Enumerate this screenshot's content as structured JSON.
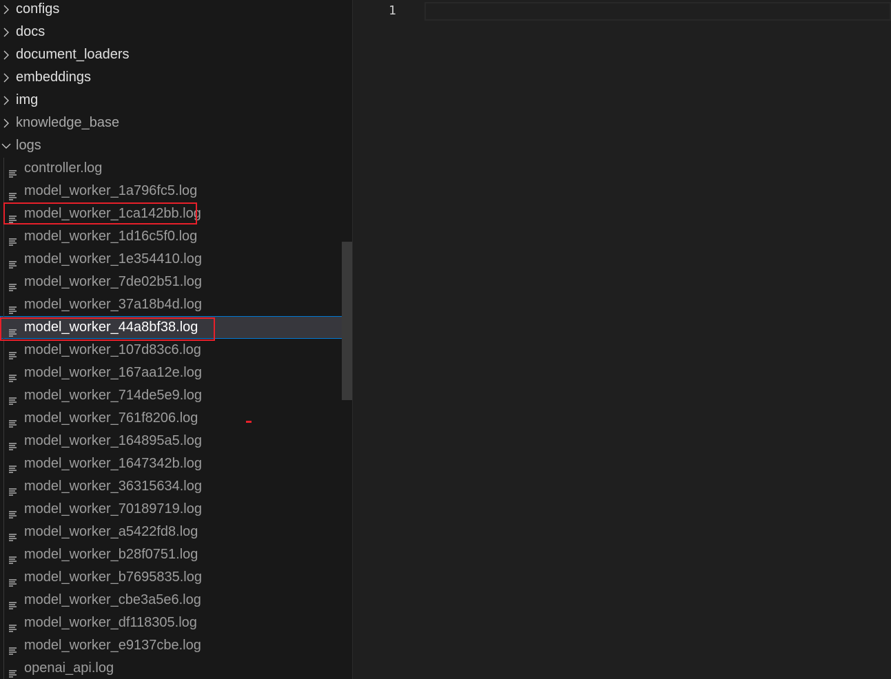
{
  "explorer": {
    "folders_top": [
      {
        "label": "configs",
        "expanded": false,
        "dim": false
      },
      {
        "label": "docs",
        "expanded": false,
        "dim": false
      },
      {
        "label": "document_loaders",
        "expanded": false,
        "dim": false
      },
      {
        "label": "embeddings",
        "expanded": false,
        "dim": false
      },
      {
        "label": "img",
        "expanded": false,
        "dim": false
      },
      {
        "label": "knowledge_base",
        "expanded": false,
        "dim": true
      },
      {
        "label": "logs",
        "expanded": true,
        "dim": true
      }
    ],
    "log_files": [
      "controller.log",
      "model_worker_1a796fc5.log",
      "model_worker_1ca142bb.log",
      "model_worker_1d16c5f0.log",
      "model_worker_1e354410.log",
      "model_worker_7de02b51.log",
      "model_worker_37a18b4d.log",
      "model_worker_44a8bf38.log",
      "model_worker_107d83c6.log",
      "model_worker_167aa12e.log",
      "model_worker_714de5e9.log",
      "model_worker_761f8206.log",
      "model_worker_164895a5.log",
      "model_worker_1647342b.log",
      "model_worker_36315634.log",
      "model_worker_70189719.log",
      "model_worker_a5422fd8.log",
      "model_worker_b28f0751.log",
      "model_worker_b7695835.log",
      "model_worker_cbe3a5e6.log",
      "model_worker_df118305.log",
      "model_worker_e9137cbe.log",
      "openai_api.log"
    ],
    "selected_file": "model_worker_44a8bf38.log",
    "highlighted_files": [
      "model_worker_1ca142bb.log",
      "model_worker_44a8bf38.log"
    ],
    "file_icon": "lines-file-icon",
    "collapsed_icon": "chevron-right-icon",
    "expanded_icon": "chevron-down-icon"
  },
  "editor": {
    "line_numbers": [
      "1"
    ]
  },
  "colors": {
    "highlight_box": "#e8202a",
    "selection_border": "#0078d4",
    "selection_bg": "#37373d"
  }
}
